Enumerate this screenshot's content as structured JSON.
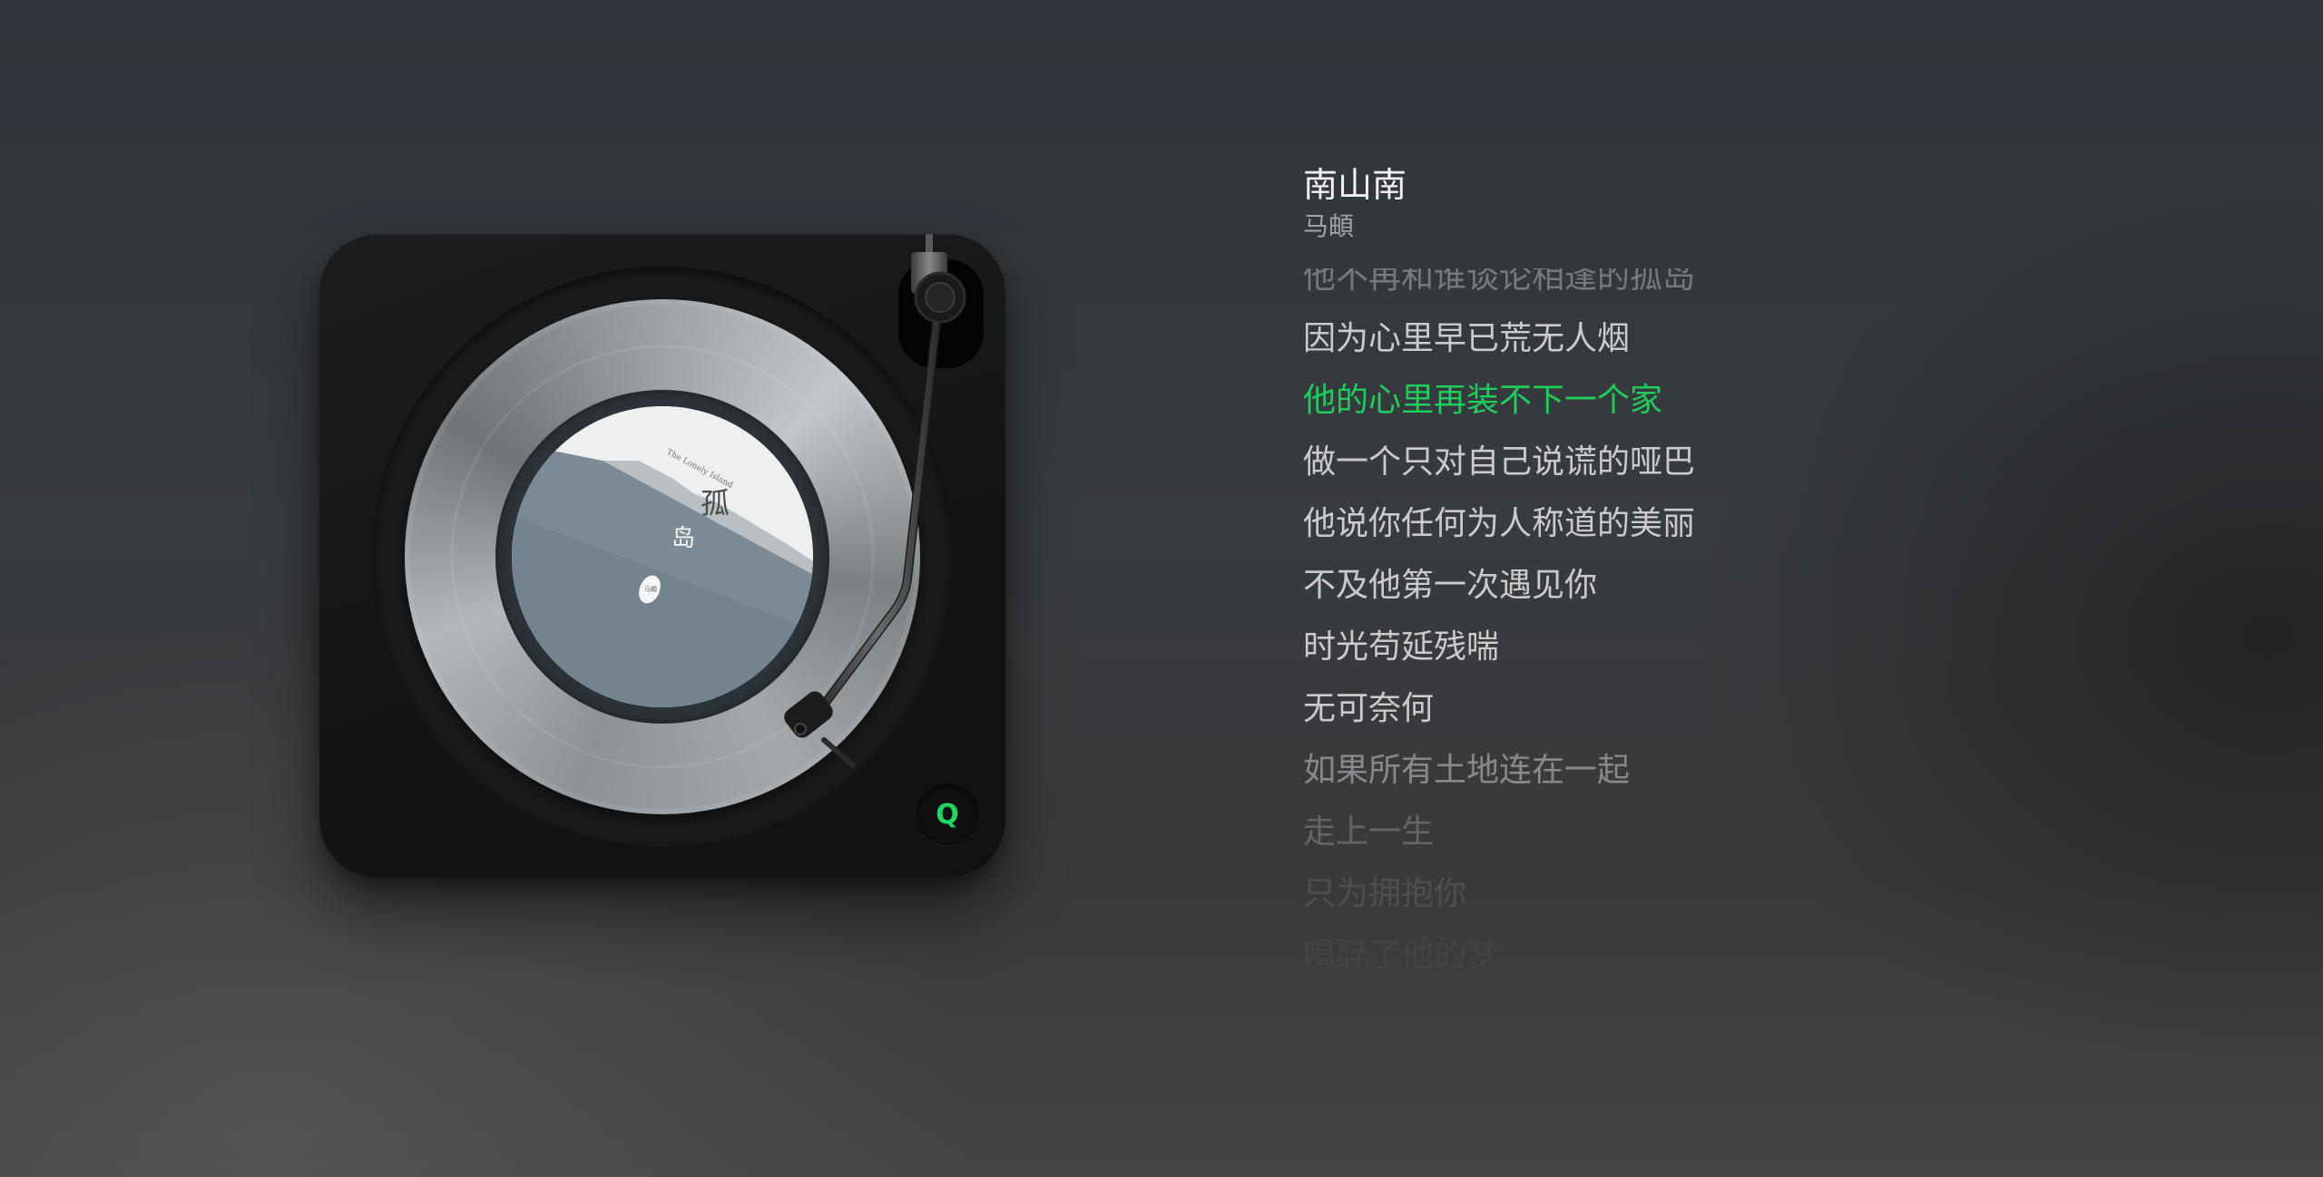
{
  "song": {
    "title": "南山南",
    "artist": "马頔"
  },
  "player": {
    "button_label": "Q",
    "accent_color": "#1ed760",
    "album_art": {
      "script_text": "The Lonely Island",
      "title_chars": [
        "孤",
        "岛"
      ],
      "seal_text": "马頔"
    }
  },
  "lyrics": {
    "active_index": 2,
    "active_color": "#1ecd5c",
    "lines": [
      "他不再和谁谈论相逢的孤岛",
      "因为心里早已荒无人烟",
      "他的心里再装不下一个家",
      "做一个只对自己说谎的哑巴",
      "他说你任何为人称道的美丽",
      "不及他第一次遇见你",
      "时光苟延残喘",
      "无可奈何",
      "如果所有土地连在一起",
      "走上一生",
      "只为拥抱你",
      "喝醉了他的梦"
    ]
  }
}
